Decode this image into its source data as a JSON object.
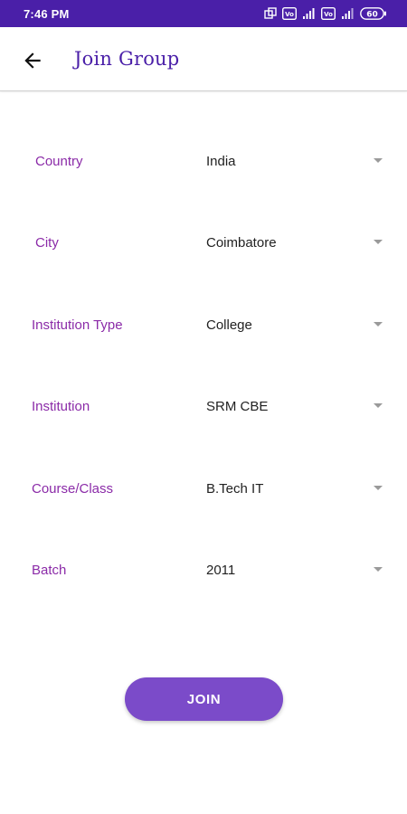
{
  "status_bar": {
    "time": "7:46 PM",
    "battery": "60",
    "network_labels": [
      "Vo",
      "Vo"
    ],
    "icons": [
      "screen-cast-icon",
      "volte-icon",
      "signal-icon",
      "volte-icon",
      "signal-icon",
      "battery-icon"
    ]
  },
  "app_bar": {
    "title": "Join Group",
    "back_icon": "arrow-left-icon"
  },
  "form": {
    "rows": [
      {
        "label": "Country",
        "value": "India"
      },
      {
        "label": "City",
        "value": "Coimbatore"
      },
      {
        "label": "Institution Type",
        "value": "College"
      },
      {
        "label": "Institution",
        "value": "SRM CBE"
      },
      {
        "label": "Course/Class",
        "value": "B.Tech IT"
      },
      {
        "label": "Batch",
        "value": "2011"
      }
    ]
  },
  "join_button": {
    "label": "JOIN"
  },
  "colors": {
    "primary": "#4a1fa8",
    "label": "#8b2ba8",
    "button": "#7b4bc9",
    "dropdown_arrow": "#9a9a9a"
  }
}
